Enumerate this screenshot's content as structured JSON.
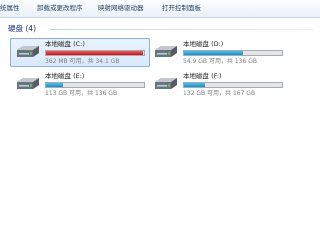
{
  "toolbar": {
    "items": [
      "统属性",
      "卸载或更改程序",
      "映射网络驱动器",
      "打开控制面板"
    ]
  },
  "group": {
    "title": "硬盘 (4)"
  },
  "drives": [
    {
      "name": "本地磁盘 (C:)",
      "free_text": "362 MB 可用，共 34.1 GB",
      "used_fraction": 0.99,
      "bar_color": "#cc1212",
      "icon": "hard-drive-icon"
    },
    {
      "name": "本地磁盘 (D:)",
      "free_text": "54.9 GB 可用，共 136 GB",
      "used_fraction": 0.6,
      "bar_color": "#1c8ec8",
      "icon": "hard-drive-icon"
    },
    {
      "name": "本地磁盘 (E:)",
      "free_text": "113 GB 可用，共 136 GB",
      "used_fraction": 0.17,
      "bar_color": "#1c8ec8",
      "icon": "hard-drive-icon"
    },
    {
      "name": "本地磁盘 (F:)",
      "free_text": "132 GB 可用，共 167 GB",
      "used_fraction": 0.21,
      "bar_color": "#1c8ec8",
      "icon": "hard-drive-icon"
    }
  ]
}
